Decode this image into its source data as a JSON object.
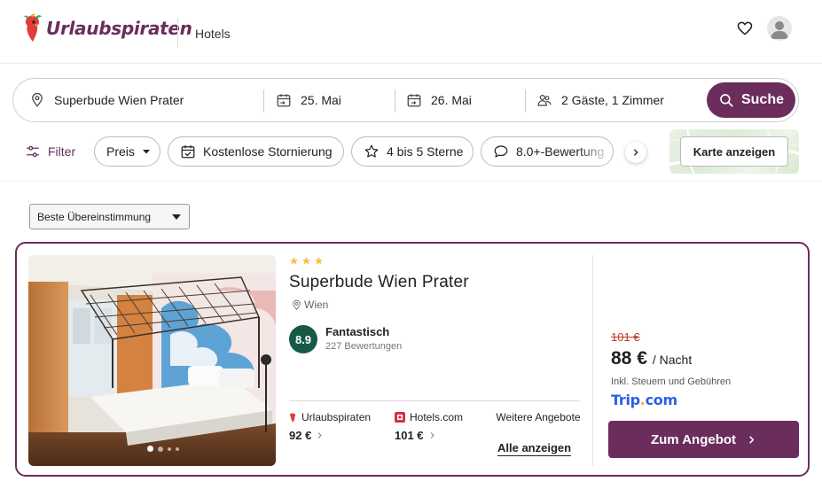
{
  "header": {
    "brand": "Urlaubspiraten",
    "nav_label": "Hotels"
  },
  "search": {
    "destination": "Superbude Wien Prater",
    "checkin": "25. Mai",
    "checkout": "26. Mai",
    "guests": "2 Gäste, 1 Zimmer",
    "button_label": "Suche"
  },
  "filters": {
    "filter_label": "Filter",
    "chips": [
      {
        "label": "Preis",
        "icon": "caret-down-icon"
      },
      {
        "label": "Kostenlose Stornierung",
        "icon": "calendar-check-icon"
      },
      {
        "label": "4 bis 5 Sterne",
        "icon": "star-outline-icon"
      },
      {
        "label": "8.0+-Bewertung",
        "icon": "speech-bubble-icon"
      }
    ],
    "map_button": "Karte anzeigen"
  },
  "sort": {
    "selected": "Beste Übereinstimmung"
  },
  "hotel": {
    "star_count": 3,
    "name": "Superbude Wien Prater",
    "location": "Wien",
    "score": "8.9",
    "score_label": "Fantastisch",
    "review_count": "227 Bewertungen",
    "image_count_dots": 4,
    "active_image": 0,
    "providers": [
      {
        "name": "Urlaubspiraten",
        "price": "92 €",
        "icon": "parrot-icon"
      },
      {
        "name": "Hotels.com",
        "price": "101 €",
        "icon": "hotels-com-icon"
      }
    ],
    "more_offers": "Weitere Angebote",
    "show_all": "Alle anzeigen",
    "old_price": "101 €",
    "price": "88 €",
    "per_night": "/ Nacht",
    "tax_note": "Inkl. Steuern und Gebühren",
    "provider_logo_part1": "Trip",
    "provider_logo_part2": ".",
    "provider_logo_part3": "com",
    "cta": "Zum Angebot"
  },
  "colors": {
    "brand": "#6b2d5c",
    "score_badge": "#155946",
    "old_price": "#c0392b",
    "trip_blue": "#2c5ee8",
    "star": "#f5c24c"
  }
}
